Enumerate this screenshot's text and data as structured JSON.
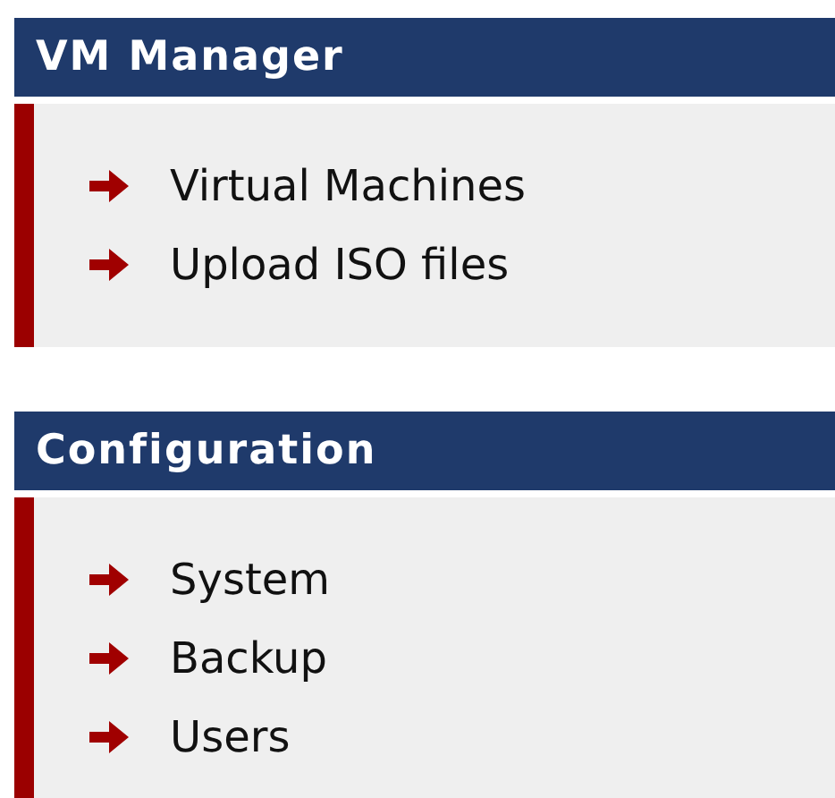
{
  "sections": [
    {
      "title": "VM Manager",
      "items": [
        {
          "label": "Virtual Machines"
        },
        {
          "label": "Upload ISO files"
        }
      ]
    },
    {
      "title": "Configuration",
      "items": [
        {
          "label": "System"
        },
        {
          "label": "Backup"
        },
        {
          "label": "Users"
        }
      ]
    }
  ]
}
